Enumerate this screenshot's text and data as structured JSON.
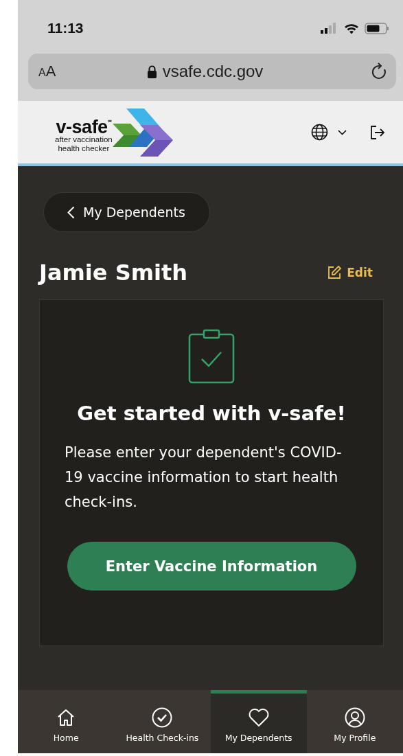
{
  "status_bar": {
    "time": "11:13"
  },
  "browser": {
    "text_size_button": "AA",
    "url": "vsafe.cdc.gov"
  },
  "header": {
    "logo": {
      "wordmark": "v-safe",
      "mark": "℠",
      "tagline": [
        "after vaccination",
        "health checker"
      ]
    }
  },
  "back_button": {
    "label": "My Dependents"
  },
  "dependent": {
    "name": "Jamie Smith",
    "edit_label": "Edit"
  },
  "card": {
    "heading": "Get started with v-safe!",
    "message": "Please enter your dependent's COVID-19 vaccine information to start health check-ins.",
    "button": "Enter Vaccine Information"
  },
  "nav": [
    {
      "kind": "home",
      "label": "Home",
      "selected": false
    },
    {
      "kind": "checkins",
      "label": "Health Check-ins",
      "selected": false
    },
    {
      "kind": "dependents",
      "label": "My Dependents",
      "selected": true
    },
    {
      "kind": "profile",
      "label": "My Profile",
      "selected": false
    }
  ]
}
